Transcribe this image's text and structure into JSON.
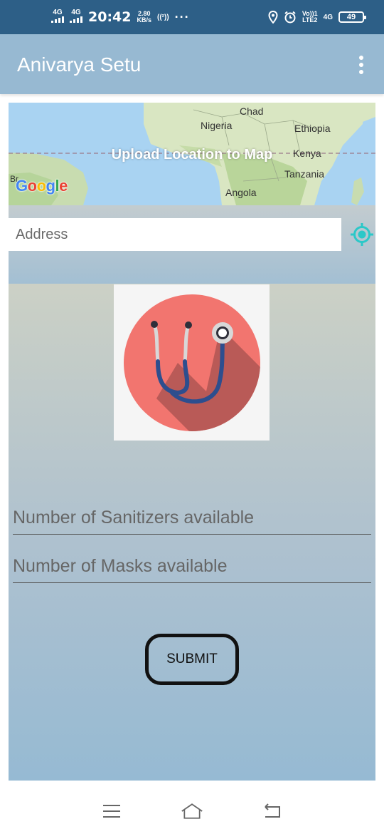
{
  "status_bar": {
    "network_1": "4G",
    "network_2": "4G",
    "time": "20:42",
    "speed_value": "2.80",
    "speed_unit": "KB/s",
    "hotspot": "((²))",
    "more": "···",
    "volte": "Vo))1",
    "lte": "LTE2",
    "net_4g": "4G",
    "battery": "49"
  },
  "app_bar": {
    "title": "Anivarya Setu"
  },
  "map": {
    "upload_label": "Upload Location to Map",
    "labels": {
      "chad": "Chad",
      "nigeria": "Nigeria",
      "ethiopia": "Ethiopia",
      "kenya": "Kenya",
      "tanzania": "Tanzania",
      "angola": "Angola",
      "brazil": "Br"
    },
    "provider_logo": "Google"
  },
  "address": {
    "placeholder": "Address"
  },
  "form": {
    "sanitizers_placeholder": "Number of Sanitizers available",
    "masks_placeholder": "Number of Masks available",
    "submit_label": "SUBMIT"
  },
  "colors": {
    "status_bar": "#2d5f87",
    "app_bar": "#97b9d2",
    "accent": "#2bc8c8",
    "logo_circle": "#f2756f"
  },
  "icons": {
    "menu": "overflow-menu-icon",
    "locate": "my-location-icon",
    "logo": "stethoscope-icon",
    "nav_recents": "recents-icon",
    "nav_home": "home-icon",
    "nav_back": "back-icon"
  }
}
